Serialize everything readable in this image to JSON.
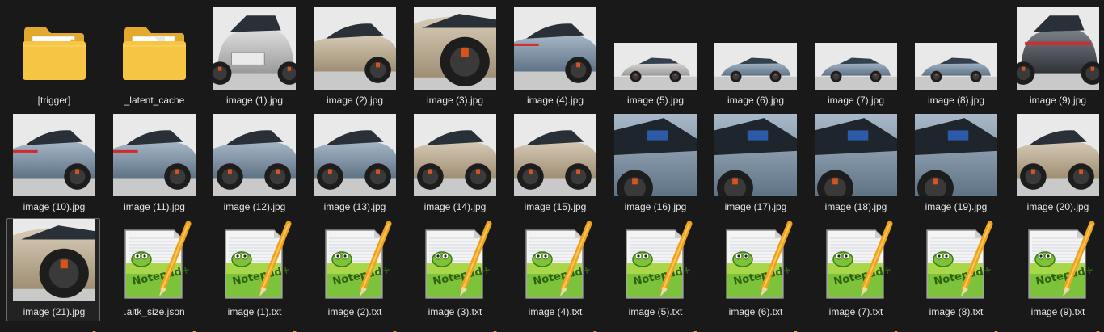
{
  "explorer": {
    "rows": [
      [
        {
          "name": "[trigger]",
          "kind": "folder-doc"
        },
        {
          "name": "_latent_cache",
          "kind": "folder"
        },
        {
          "name": "image (1).jpg",
          "kind": "image",
          "size": "big",
          "scene": "front",
          "tone": "silver"
        },
        {
          "name": "image (2).jpg",
          "kind": "image",
          "size": "big",
          "scene": "front-side",
          "tone": "bronze"
        },
        {
          "name": "image (3).jpg",
          "kind": "image",
          "size": "big",
          "scene": "wheel",
          "tone": "bronze"
        },
        {
          "name": "image (4).jpg",
          "kind": "image",
          "size": "big",
          "scene": "rear-side",
          "tone": "blue"
        },
        {
          "name": "image (5).jpg",
          "kind": "image",
          "size": "small",
          "scene": "whole",
          "tone": "silver"
        },
        {
          "name": "image (6).jpg",
          "kind": "image",
          "size": "small",
          "scene": "whole",
          "tone": "blue"
        },
        {
          "name": "image (7).jpg",
          "kind": "image",
          "size": "small",
          "scene": "whole",
          "tone": "blue"
        },
        {
          "name": "image (8).jpg",
          "kind": "image",
          "size": "small",
          "scene": "whole",
          "tone": "blue"
        },
        {
          "name": "image (9).jpg",
          "kind": "image",
          "size": "big",
          "scene": "rear",
          "tone": "dark"
        }
      ],
      [
        {
          "name": "image (10).jpg",
          "kind": "image",
          "size": "big",
          "scene": "rear-side",
          "tone": "blue"
        },
        {
          "name": "image (11).jpg",
          "kind": "image",
          "size": "big",
          "scene": "rear-side",
          "tone": "blue"
        },
        {
          "name": "image (12).jpg",
          "kind": "image",
          "size": "big",
          "scene": "side",
          "tone": "blue"
        },
        {
          "name": "image (13).jpg",
          "kind": "image",
          "size": "big",
          "scene": "side",
          "tone": "blue"
        },
        {
          "name": "image (14).jpg",
          "kind": "image",
          "size": "big",
          "scene": "side",
          "tone": "bronze"
        },
        {
          "name": "image (15).jpg",
          "kind": "image",
          "size": "big",
          "scene": "side",
          "tone": "bronze"
        },
        {
          "name": "image (16).jpg",
          "kind": "image",
          "size": "big",
          "scene": "interior",
          "tone": "blue"
        },
        {
          "name": "image (17).jpg",
          "kind": "image",
          "size": "big",
          "scene": "interior",
          "tone": "blue"
        },
        {
          "name": "image (18).jpg",
          "kind": "image",
          "size": "big",
          "scene": "interior",
          "tone": "blue"
        },
        {
          "name": "image (19).jpg",
          "kind": "image",
          "size": "big",
          "scene": "interior",
          "tone": "blue"
        },
        {
          "name": "image (20).jpg",
          "kind": "image",
          "size": "big",
          "scene": "side",
          "tone": "bronze"
        }
      ],
      [
        {
          "name": "image (21).jpg",
          "kind": "image",
          "size": "big",
          "scene": "wheel",
          "tone": "bronze",
          "selected": true
        },
        {
          "name": ".aitk_size.json",
          "kind": "notepad"
        },
        {
          "name": "image (1).txt",
          "kind": "notepad"
        },
        {
          "name": "image (2).txt",
          "kind": "notepad"
        },
        {
          "name": "image (3).txt",
          "kind": "notepad"
        },
        {
          "name": "image (4).txt",
          "kind": "notepad"
        },
        {
          "name": "image (5).txt",
          "kind": "notepad"
        },
        {
          "name": "image (6).txt",
          "kind": "notepad"
        },
        {
          "name": "image (7).txt",
          "kind": "notepad"
        },
        {
          "name": "image (8).txt",
          "kind": "notepad"
        },
        {
          "name": "image (9).txt",
          "kind": "notepad"
        }
      ]
    ],
    "next_row_kind": "notepad",
    "icons": {
      "folder": "folder-icon",
      "notepad": "notepad-plus-plus-icon",
      "image": "image-thumbnail"
    },
    "colors": {
      "background": "#191919",
      "label": "#e6e6e6",
      "selection_border": "#6b6b6b",
      "folder_yellow": "#f6c544",
      "notepad_green": "#7cc23a",
      "pencil_orange": "#f0a21c",
      "brake_orange": "#d8541c",
      "taillight_red": "#d22b2b"
    }
  }
}
